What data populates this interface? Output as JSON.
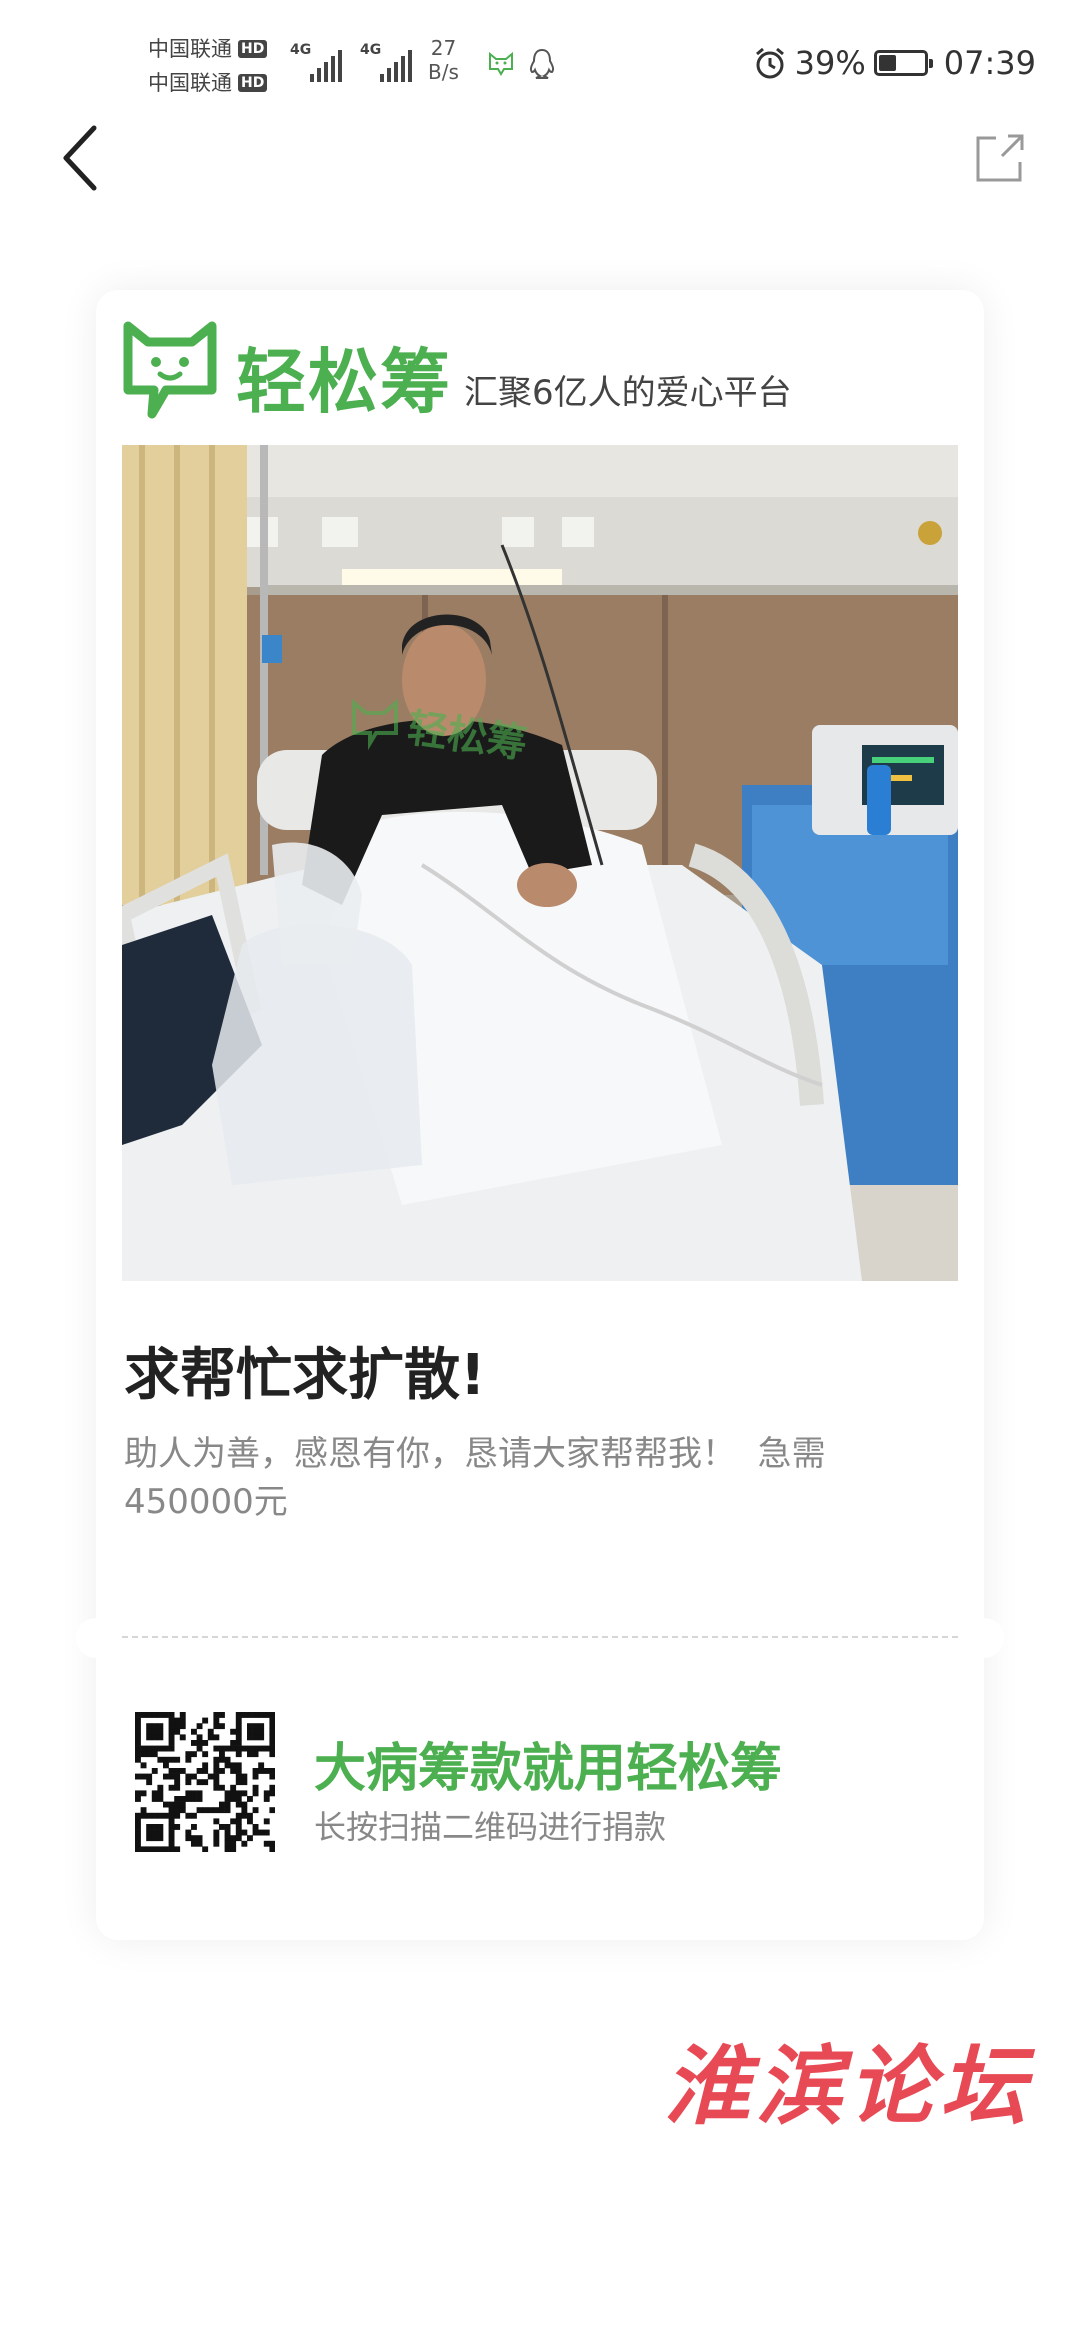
{
  "status_bar": {
    "carrier_1": "中国联通",
    "carrier_2": "中国联通",
    "hd_label": "HD",
    "network_1": "4G",
    "network_2": "4G",
    "speed_value": "27",
    "speed_unit": "B/s",
    "battery_percent": "39%",
    "battery_level": 0.39,
    "time": "07:39"
  },
  "card": {
    "brand_name": "轻松筹",
    "brand_slogan": "汇聚6亿人的爱心平台",
    "photo_watermark": "轻松筹",
    "title": "求帮忙求扩散!",
    "description": "助人为善，感恩有你，恳请大家帮帮我！  急需450000元",
    "cta_title": "大病筹款就用轻松筹",
    "cta_subtitle": "长按扫描二维码进行捐款"
  },
  "watermark": "淮滨论坛",
  "colors": {
    "brand_green": "#4caf50",
    "watermark_red": "#e84a55"
  },
  "icons": {
    "back": "chevron-left-icon",
    "share": "share-icon",
    "alarm": "alarm-icon",
    "battery": "battery-icon",
    "cat_notif": "cat-app-icon",
    "qq_notif": "qq-penguin-icon",
    "brand_logo": "cat-chat-logo-icon"
  }
}
